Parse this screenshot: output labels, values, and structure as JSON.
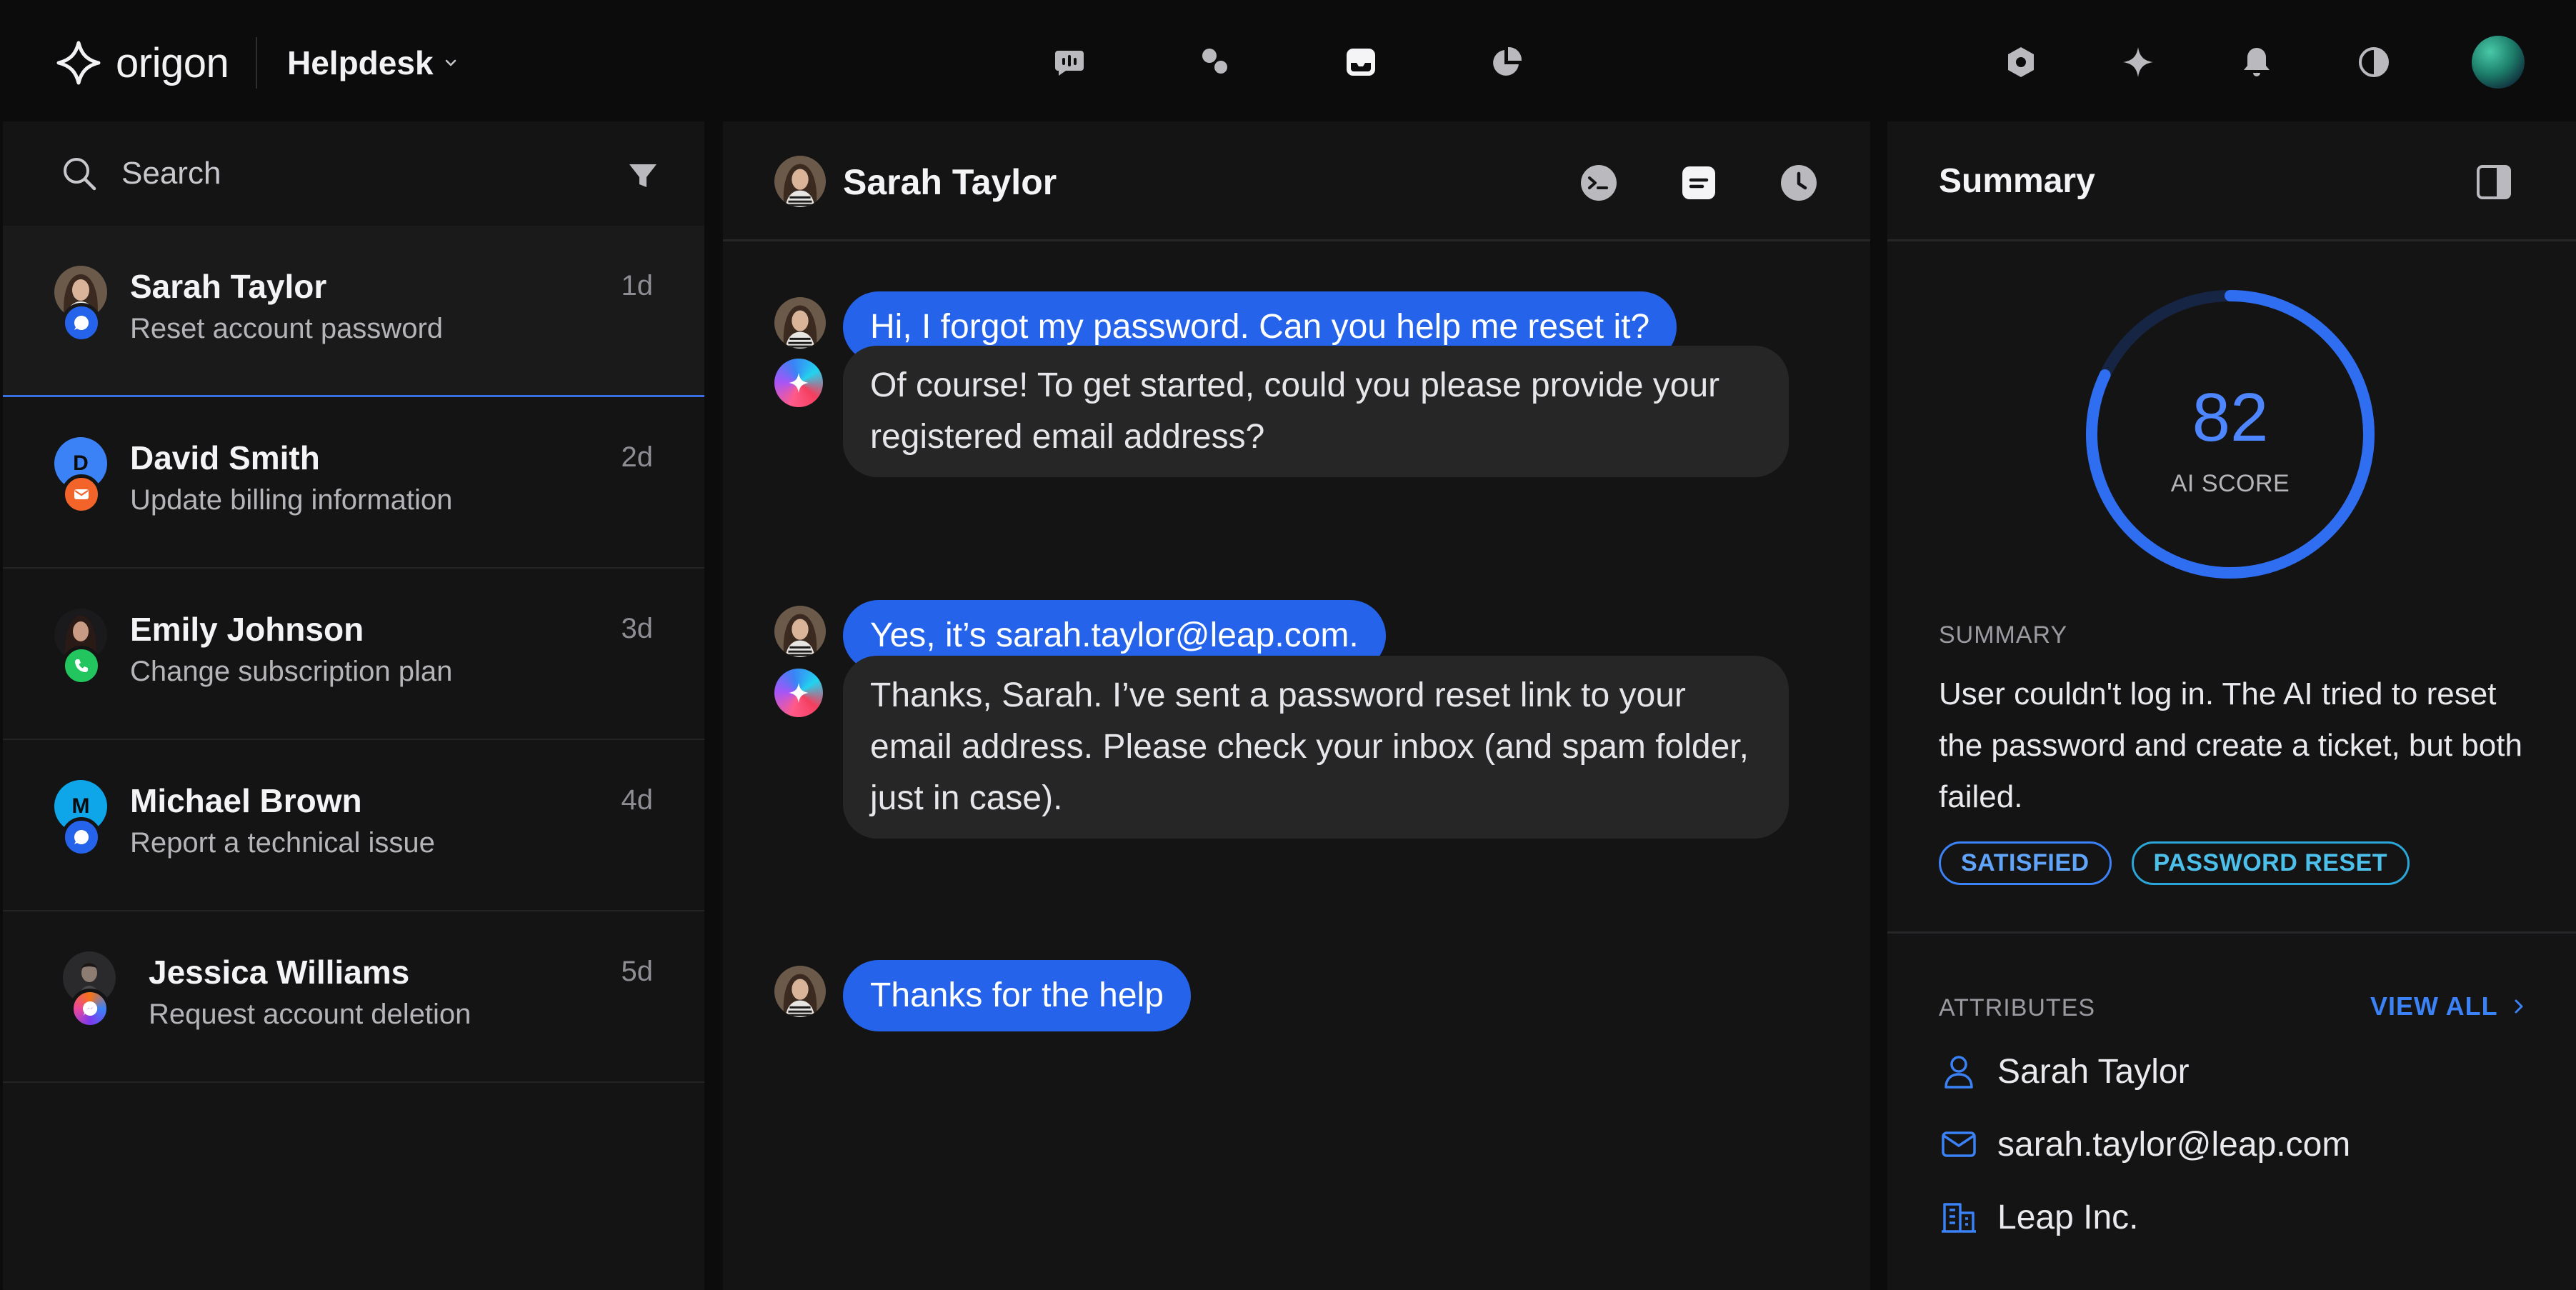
{
  "app": {
    "brand": "origon",
    "workspace": "Helpdesk"
  },
  "colors": {
    "accent": "#2563eb",
    "ring": "#2f6ef0",
    "tag_blue": "#3b82f6",
    "tag_teal": "#2aa7d8"
  },
  "topbar": {
    "nav_icons": [
      "voice-icon",
      "bubbles-icon",
      "inbox-icon",
      "reports-icon"
    ],
    "right_icons": [
      "settings-icon",
      "sparkle-icon",
      "bell-icon",
      "contrast-icon"
    ]
  },
  "search": {
    "placeholder": "Search"
  },
  "conversations": [
    {
      "name": "Sarah Taylor",
      "subject": "Reset account password",
      "time": "1d",
      "channel": "chat"
    },
    {
      "name": "David Smith",
      "subject": "Update billing information",
      "time": "2d",
      "channel": "email",
      "initial": "D"
    },
    {
      "name": "Emily Johnson",
      "subject": "Change subscription plan",
      "time": "3d",
      "channel": "phone"
    },
    {
      "name": "Michael Brown",
      "subject": "Report a technical issue",
      "time": "4d",
      "channel": "chat",
      "initial": "M"
    },
    {
      "name": "Jessica Williams",
      "subject": "Request account deletion",
      "time": "5d",
      "channel": "messenger"
    }
  ],
  "chat": {
    "title": "Sarah Taylor",
    "messages": [
      {
        "from": "user",
        "text": "Hi, I forgot my password. Can you help me reset it?"
      },
      {
        "from": "ai",
        "text": "Of course! To get started, could you please provide your registered email address?"
      },
      {
        "from": "user",
        "text": "Yes, it’s sarah.taylor@leap.com."
      },
      {
        "from": "ai",
        "text": "Thanks, Sarah. I’ve sent a password reset link to your email address. Please check your inbox (and spam folder, just in case)."
      },
      {
        "from": "user",
        "text": "Thanks for the help"
      }
    ]
  },
  "summary": {
    "title": "Summary",
    "score": 82,
    "score_fraction": 0.82,
    "score_label": "AI SCORE",
    "section_label": "SUMMARY",
    "text": "User couldn't log in. The AI tried to reset the password and create a ticket, but both failed.",
    "tags": [
      "SATISFIED",
      "PASSWORD RESET"
    ],
    "attributes_label": "ATTRIBUTES",
    "view_all": "VIEW ALL",
    "attributes": [
      {
        "icon": "user-icon",
        "value": "Sarah Taylor"
      },
      {
        "icon": "mail-icon",
        "value": "sarah.taylor@leap.com"
      },
      {
        "icon": "building-icon",
        "value": "Leap Inc."
      }
    ]
  }
}
